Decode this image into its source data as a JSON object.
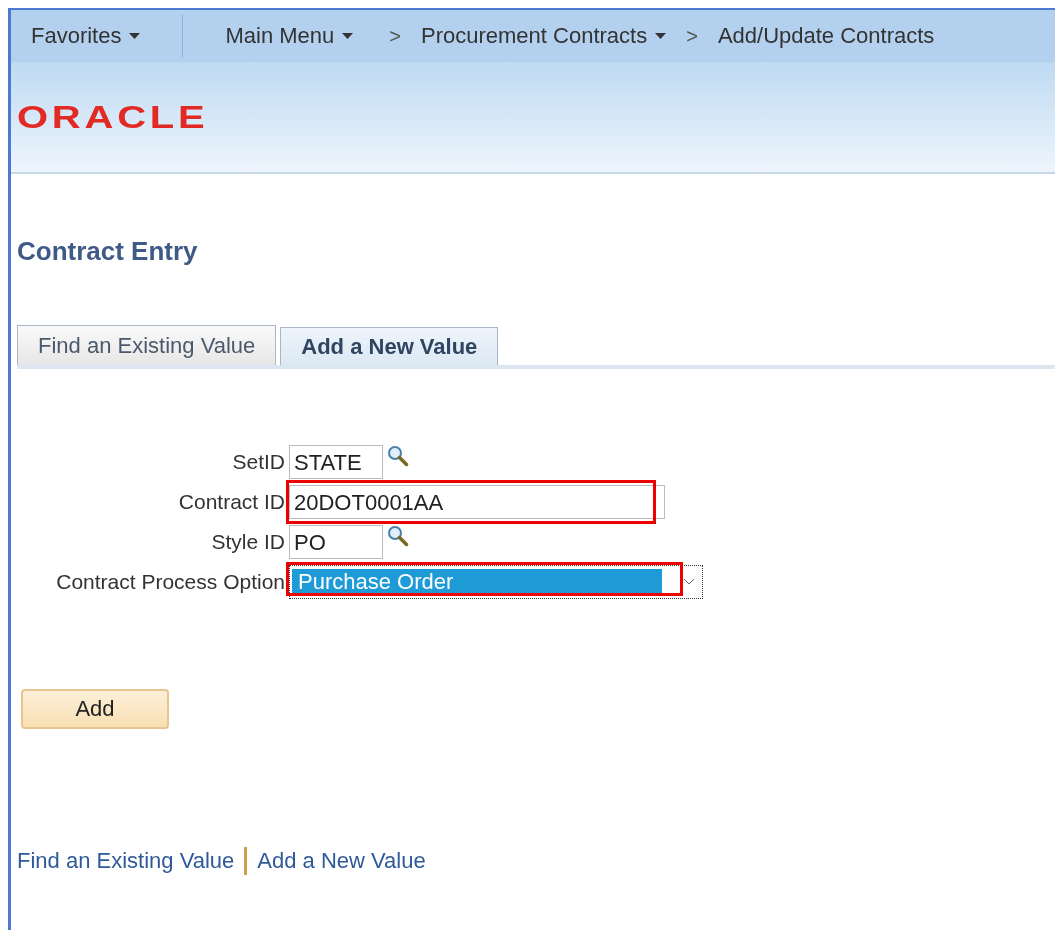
{
  "nav": {
    "items": [
      {
        "label": "Favorites",
        "dropdown": true
      },
      {
        "label": "Main Menu",
        "dropdown": true,
        "divider_before": true
      },
      {
        "label": "Procurement Contracts",
        "dropdown": true,
        "separator": ">"
      },
      {
        "label": "Add/Update Contracts",
        "dropdown": false,
        "separator": ">"
      }
    ]
  },
  "header": {
    "logo": "ORACLE"
  },
  "page_title": "Contract Entry",
  "tabs": [
    {
      "label": "Find an Existing Value",
      "selected": false
    },
    {
      "label": "Add a New Value",
      "selected": true
    }
  ],
  "form": {
    "fields": [
      {
        "label": "SetID",
        "value": "STATE",
        "kind": "lookup",
        "highlighted": false
      },
      {
        "label": "Contract ID",
        "value": "20DOT0001AA",
        "kind": "text",
        "highlighted": true
      },
      {
        "label": "Style ID",
        "value": "PO",
        "kind": "lookup",
        "highlighted": false
      },
      {
        "label": "Contract Process Option",
        "value": "Purchase Order",
        "kind": "select",
        "highlighted": true
      }
    ]
  },
  "add_button": "Add",
  "footer_links": [
    {
      "label": "Find an Existing Value"
    },
    {
      "label": "Add a New Value"
    }
  ]
}
